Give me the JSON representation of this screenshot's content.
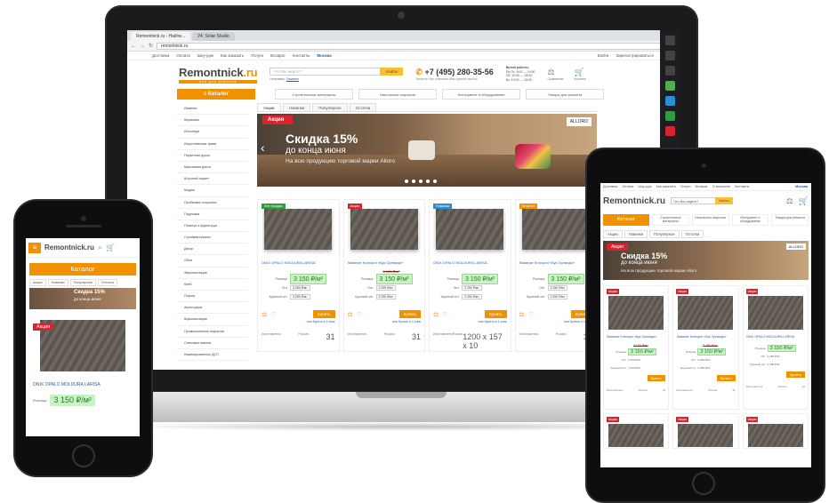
{
  "browser": {
    "tabs": [
      "Remontnick.ru - Найти...",
      "24: Solar Studio"
    ],
    "url": "remontnick.ru",
    "window_label": "Михаил"
  },
  "site": {
    "logo_main": "Remontnick",
    "logo_tld": ".ru",
    "logo_sub": "всё для ремонта",
    "topnav": [
      "Доставка",
      "Оплата",
      "Шоу-рум",
      "Как заказать",
      "Услуги",
      "Возврат",
      "Контакты"
    ],
    "city": "Москва",
    "topnav_right": [
      "Войти",
      "Зарегистрироваться"
    ],
    "search_placeholder": "Что Вы ищете?",
    "search_button": "Найти",
    "search_example_label": "Например:",
    "search_example": "Ламинат",
    "phone": "+7 (495) 280-35-56",
    "phone_sub": "Звоните! Мы поможем Вам сделать выбор",
    "hours_title": "Время работы:",
    "hours": [
      "Пн-Пт: 9:00 — 19:00",
      "Сб: 10:00 — 18:00",
      "Вс: 10:00 — 18:00"
    ],
    "compare_label": "Сравнение",
    "cart_label": "Корзина",
    "catalog_button": "Каталог",
    "category_dropdowns": [
      "Строительные материалы",
      "Напольные покрытия",
      "Инструмент и оборудование",
      "Товары для ремонта"
    ],
    "sidebar": [
      "Ламинат",
      "Керамика",
      "Линолеум",
      "Искусственная трава",
      "Паркетная доска",
      "Массивная доска",
      "Штучный паркет",
      "Модем",
      "Пробковые покрытия",
      "Подложка",
      "Плинтус и фурнитура",
      "Стройматериалы",
      "Декор",
      "Обои",
      "Звукоизоляция",
      "Клей",
      "Порога",
      "Аксессуары",
      "Шумоизоляция",
      "Промышленные покрытия",
      "Стеновые панели",
      "Ламинированные ДСП"
    ],
    "tabs": [
      "Акции",
      "Новинки",
      "Популярное",
      "Остатки"
    ],
    "banner": {
      "tag": "Акция",
      "title": "Скидка 15%",
      "subtitle": "до конца июня",
      "text": "На всю продукцию торговой марки Alloro",
      "brand": "ALLORO"
    },
    "price_labels": [
      "Розница",
      "Опт",
      "Крупный опт"
    ],
    "buy_label": "Купить",
    "one_click": "или Купить в 1 клик",
    "country_label": "Изготовитель",
    "country": "Россия",
    "products": [
      {
        "badge": "Хит продаж",
        "badge_color": "#2e9e3f",
        "name": "ONIX OPALO MOLDURA LARISA",
        "old": "",
        "price": "3 150 ₽/м²",
        "opt": "3 250 ₽/м²",
        "krupny": "3 250 ₽/м²",
        "num": "31"
      },
      {
        "badge": "Акция",
        "badge_color": "#d9232e",
        "name": "Ламинат Kronopol «Бук Орландо»",
        "old": "3 150 ₽/м²",
        "price": "3 150 ₽/м²",
        "opt": "3 250 ₽/м²",
        "krupny": "3 250 ₽/м²",
        "num": "31"
      },
      {
        "badge": "Новинка",
        "badge_color": "#2a8fd6",
        "name": "ONIX OPALO MOLDURA LARISA",
        "old": "",
        "price": "3 150 ₽/м²",
        "opt": "3 250 ₽/м²",
        "krupny": "3 250 ₽/м²",
        "num": "1200 х 157 х 10"
      },
      {
        "badge": "Остатки",
        "badge_color": "#f29100",
        "name": "Ламинат Kronopol «Бук Орландо»",
        "old": "",
        "price": "3 150 ₽/м²",
        "opt": "3 250 ₽/м²",
        "krupny": "3 250 ₽/м²",
        "num": "31"
      }
    ]
  },
  "phone_view": {
    "logo": "Remontnick.ru",
    "catalog": "Каталог",
    "tabs": [
      "Акции",
      "Новинки",
      "Популярное",
      "Остатки"
    ],
    "banner_title": "Скидка 15%",
    "banner_sub": "до конца июня",
    "tag": "Акция",
    "name": "ONIX OPALO MOLDURA LARISA",
    "price_label": "Розница",
    "price": "3 150 ₽/м²"
  },
  "tablet_view": {
    "topnav": [
      "Доставка",
      "Оплата",
      "Шоу-рум",
      "Как заказать",
      "Услуги",
      "Возврат",
      "О магазине",
      "Контакты"
    ],
    "city": "Москва",
    "logo": "Remontnick.ru",
    "search_placeholder": "Что Вы ищете?",
    "search_button": "Найти",
    "catalog": "Каталог",
    "dropdowns": [
      "Строительные материалы",
      "Напольные покрытия",
      "Инструмент и оборудование",
      "Товары для ремонта"
    ],
    "tabs": [
      "Акции",
      "Новинки",
      "Популярное",
      "Остатки"
    ],
    "banner_tag": "Акция",
    "banner_title": "Скидка 15%",
    "banner_sub": "до конца июня",
    "banner_text": "На всю продукцию торговой марки Alloro",
    "brand": "ALLORO",
    "cards": [
      {
        "badge": "Акция",
        "name": "Ламинат Kronopol «Бук Орландо»",
        "old": "3 150 ₽/м²",
        "price": "3 150 ₽/м²",
        "opt": "3 250 ₽/м²",
        "krupny": "3 250 ₽/м²",
        "num": "31"
      },
      {
        "badge": "Акция",
        "name": "Ламинат Kronopol «Бук Орландо»",
        "old": "3 150 ₽/м²",
        "price": "3 150 ₽/м²",
        "opt": "3 250 ₽/м²",
        "krupny": "3 250 ₽/м²",
        "num": "31"
      },
      {
        "badge": "Акция",
        "name": "ONIX OPALO MOLDURA LARISA",
        "old": "",
        "price": "3 150 ₽/м²",
        "opt": "3 250 ₽/м²",
        "krupny": "3 250 ₽/м²",
        "num": "31"
      }
    ],
    "bottom_badges": [
      "Акция",
      "Акция",
      "Акция"
    ],
    "buy_label": "Купить",
    "country_label": "Изготовитель",
    "country": "Россия"
  },
  "colors": {
    "accent": "#f29100",
    "sale": "#d9232e",
    "price_bg": "#c9f2c5",
    "link": "#2a5fa8"
  }
}
